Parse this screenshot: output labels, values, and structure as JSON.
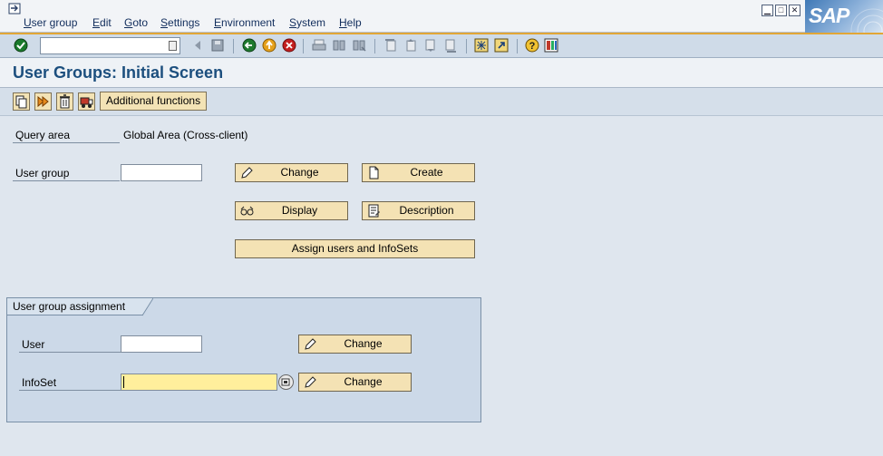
{
  "menu": {
    "items": [
      "User group",
      "Edit",
      "Goto",
      "Settings",
      "Environment",
      "System",
      "Help"
    ]
  },
  "window": {
    "logo_text": "SAP"
  },
  "toolbar": {
    "command_field_value": "",
    "icons": [
      "enter-icon",
      "back-icon",
      "save-icon",
      "back-green-icon",
      "exit-icon",
      "cancel-icon",
      "print-icon",
      "find-icon",
      "find-next-icon",
      "first-page-icon",
      "previous-page-icon",
      "next-page-icon",
      "last-page-icon",
      "create-session-icon",
      "shortcut-icon",
      "help-icon",
      "layout-menu-icon"
    ]
  },
  "page": {
    "title": "User Groups: Initial Screen"
  },
  "app_toolbar": {
    "icons": [
      "copy-icon",
      "execute-icon",
      "delete-icon",
      "transport-icon"
    ],
    "additional_functions_label": "Additional functions"
  },
  "form": {
    "query_area_label": "Query area",
    "query_area_value": "Global Area (Cross-client)",
    "user_group_label": "User group",
    "user_group_value": "",
    "buttons": {
      "change": "Change",
      "create": "Create",
      "display": "Display",
      "description": "Description",
      "assign": "Assign users and InfoSets"
    }
  },
  "assignment": {
    "title": "User group assignment",
    "user_label": "User",
    "user_value": "",
    "infoset_label": "InfoSet",
    "infoset_value": "",
    "change_label": "Change"
  },
  "colors": {
    "accent_orange": "#e2a636",
    "button_fill": "#f4e2b4",
    "title_blue": "#1c4f7e",
    "active_field": "#ffef9c"
  }
}
